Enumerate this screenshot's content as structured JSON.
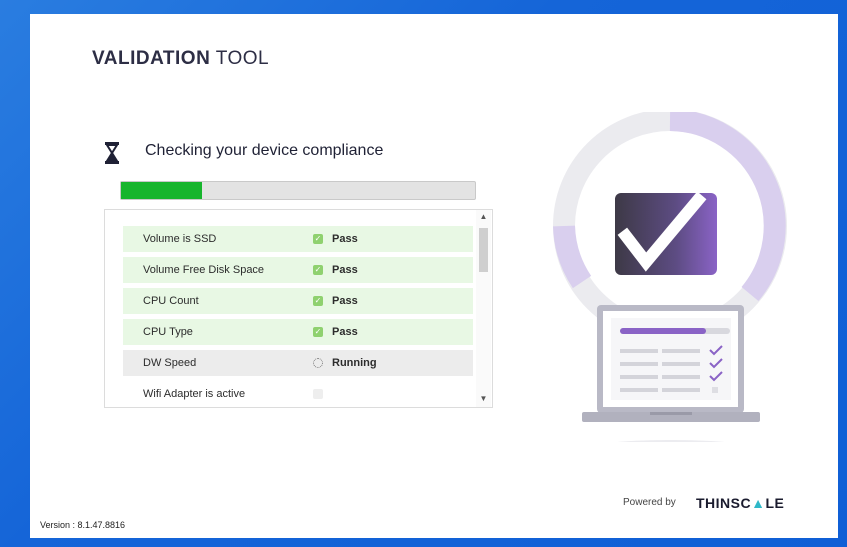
{
  "app": {
    "title_bold": "VALIDATION",
    "title_light": "TOOL"
  },
  "check": {
    "heading": "Checking your device compliance",
    "progress": 0.23
  },
  "items": [
    {
      "name": "Volume is SSD",
      "status": "Pass",
      "state": "pass"
    },
    {
      "name": "Volume Free Disk Space",
      "status": "Pass",
      "state": "pass"
    },
    {
      "name": "CPU Count",
      "status": "Pass",
      "state": "pass"
    },
    {
      "name": "CPU Type",
      "status": "Pass",
      "state": "pass"
    },
    {
      "name": "DW Speed",
      "status": "Running",
      "state": "running"
    },
    {
      "name": "Wifi Adapter is active",
      "status": "",
      "state": "pending"
    }
  ],
  "footer": {
    "powered_by": "Powered by",
    "brand_part1": "THINSC",
    "brand_part2": "LE",
    "version": "Version : 8.1.47.8816"
  },
  "colors": {
    "accent_purple": "#8a63c6",
    "pass_green": "#17b52d",
    "brand_blue": "#1565d8"
  },
  "icons": {
    "heading_icon": "hourglass-icon",
    "illustration": "laptop-checklist-illustration"
  }
}
